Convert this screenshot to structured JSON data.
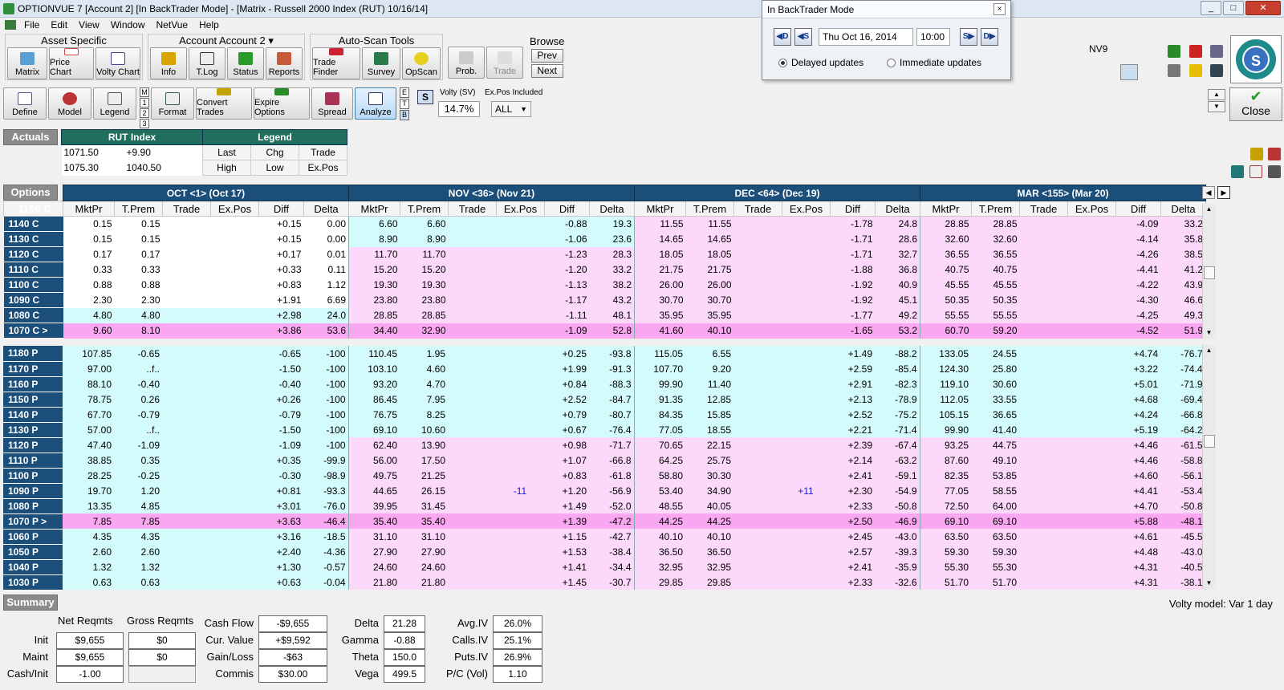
{
  "window": {
    "title": "OPTIONVUE 7   [Account 2]   [In BackTrader Mode]  - [Matrix - Russell 2000 Index (RUT)  10/16/14]"
  },
  "menu": [
    "File",
    "Edit",
    "View",
    "Window",
    "NetVue",
    "Help"
  ],
  "toolbar1": {
    "asset_label": "Asset Specific",
    "asset_buttons": [
      "Matrix",
      "Price Chart",
      "Volty Chart"
    ],
    "account_label": "Account Account 2 ▾",
    "account_buttons": [
      "Info",
      "T.Log",
      "Status",
      "Reports"
    ],
    "autoscan_label": "Auto-Scan Tools",
    "autoscan_buttons": [
      "Trade Finder",
      "Survey",
      "OpScan"
    ],
    "prob": "Prob.",
    "trade": "Trade",
    "browse_label": "Browse",
    "prev": "Prev",
    "next": "Next",
    "nv9": "NV9"
  },
  "toolbar2": {
    "buttons": [
      "Define",
      "Model",
      "Legend",
      "Format",
      "Convert Trades",
      "Expire Options",
      "Spread",
      "Analyze"
    ],
    "stack": [
      "M",
      "1",
      "2",
      "3"
    ],
    "etb": [
      "E",
      "T",
      "B"
    ],
    "s_btn": "S",
    "volty_label": "Volty (SV)",
    "volty_value": "14.7%",
    "expos_label": "Ex.Pos Included",
    "expos_value": "ALL",
    "close": "Close"
  },
  "backtrader": {
    "title": "In BackTrader Mode",
    "close": "×",
    "btn1": "◀D",
    "btn2": "◀S",
    "date": "Thu Oct 16, 2014",
    "time": "10:00",
    "btn3": "S▶",
    "btn4": "D▶",
    "radio1": "Delayed updates",
    "radio2": "Immediate updates"
  },
  "actuals": {
    "label": "Actuals",
    "index_header": "RUT Index",
    "legend_header": "Legend",
    "values": [
      "1071.50",
      "+9.90",
      "1075.30",
      "1040.50"
    ],
    "legend": [
      "Last",
      "Chg",
      "Trade",
      "High",
      "Low",
      "Ex.Pos"
    ]
  },
  "options": {
    "label": "Options",
    "months": [
      "OCT <1> (Oct 17)",
      "NOV <36> (Nov 21)",
      "DEC <64> (Dec 19)",
      "MAR <155> (Mar 20)"
    ],
    "col_headers": [
      "MktPr",
      "T.Prem",
      "Trade",
      "Ex.Pos",
      "Diff",
      "Delta"
    ],
    "calls": [
      {
        "s": "1150 C",
        "c": "white",
        "m": [
          [
            "",
            "",
            "",
            "",
            "",
            ""
          ],
          [
            "",
            "",
            "",
            "",
            "",
            ""
          ],
          [
            "",
            "",
            "",
            "",
            "",
            ""
          ],
          [
            "",
            "",
            "",
            "",
            "",
            ""
          ]
        ]
      },
      {
        "s": "1140 C",
        "c": "white",
        "m": [
          [
            "0.15",
            "0.15",
            "",
            "",
            "+0.15",
            "0.00"
          ],
          [
            "6.60",
            "6.60",
            "",
            "",
            "-0.88",
            "19.3"
          ],
          [
            "11.55",
            "11.55",
            "",
            "",
            "-1.78",
            "24.8"
          ],
          [
            "28.85",
            "28.85",
            "",
            "",
            "-4.09",
            "33.2"
          ]
        ]
      },
      {
        "s": "1130 C",
        "c": "white",
        "m": [
          [
            "0.15",
            "0.15",
            "",
            "",
            "+0.15",
            "0.00"
          ],
          [
            "8.90",
            "8.90",
            "",
            "",
            "-1.06",
            "23.6"
          ],
          [
            "14.65",
            "14.65",
            "",
            "",
            "-1.71",
            "28.6"
          ],
          [
            "32.60",
            "32.60",
            "",
            "",
            "-4.14",
            "35.8"
          ]
        ]
      },
      {
        "s": "1120 C",
        "c": "white",
        "m": [
          [
            "0.17",
            "0.17",
            "",
            "",
            "+0.17",
            "0.01"
          ],
          [
            "11.70",
            "11.70",
            "",
            "",
            "-1.23",
            "28.3"
          ],
          [
            "18.05",
            "18.05",
            "",
            "",
            "-1.71",
            "32.7"
          ],
          [
            "36.55",
            "36.55",
            "",
            "",
            "-4.26",
            "38.5"
          ]
        ]
      },
      {
        "s": "1110 C",
        "c": "white",
        "m": [
          [
            "0.33",
            "0.33",
            "",
            "",
            "+0.33",
            "0.11"
          ],
          [
            "15.20",
            "15.20",
            "",
            "",
            "-1.20",
            "33.2"
          ],
          [
            "21.75",
            "21.75",
            "",
            "",
            "-1.88",
            "36.8"
          ],
          [
            "40.75",
            "40.75",
            "",
            "",
            "-4.41",
            "41.2"
          ]
        ]
      },
      {
        "s": "1100 C",
        "c": "white",
        "m": [
          [
            "0.88",
            "0.88",
            "",
            "",
            "+0.83",
            "1.12"
          ],
          [
            "19.30",
            "19.30",
            "",
            "",
            "-1.13",
            "38.2"
          ],
          [
            "26.00",
            "26.00",
            "",
            "",
            "-1.92",
            "40.9"
          ],
          [
            "45.55",
            "45.55",
            "",
            "",
            "-4.22",
            "43.9"
          ]
        ]
      },
      {
        "s": "1090 C",
        "c": "white",
        "m": [
          [
            "2.30",
            "2.30",
            "",
            "",
            "+1.91",
            "6.69"
          ],
          [
            "23.80",
            "23.80",
            "",
            "",
            "-1.17",
            "43.2"
          ],
          [
            "30.70",
            "30.70",
            "",
            "",
            "-1.92",
            "45.1"
          ],
          [
            "50.35",
            "50.35",
            "",
            "",
            "-4.30",
            "46.6"
          ]
        ]
      },
      {
        "s": "1080 C",
        "c": "cyan",
        "m": [
          [
            "4.80",
            "4.80",
            "",
            "",
            "+2.98",
            "24.0"
          ],
          [
            "28.85",
            "28.85",
            "",
            "",
            "-1.11",
            "48.1"
          ],
          [
            "35.95",
            "35.95",
            "",
            "",
            "-1.77",
            "49.2"
          ],
          [
            "55.55",
            "55.55",
            "",
            "",
            "-4.25",
            "49.3"
          ]
        ]
      },
      {
        "s": "1070 C >",
        "c": "atm",
        "m": [
          [
            "9.60",
            "8.10",
            "",
            "",
            "+3.86",
            "53.6"
          ],
          [
            "34.40",
            "32.90",
            "",
            "",
            "-1.09",
            "52.8"
          ],
          [
            "41.60",
            "40.10",
            "",
            "",
            "-1.65",
            "53.2"
          ],
          [
            "60.70",
            "59.20",
            "",
            "",
            "-4.52",
            "51.9"
          ]
        ]
      }
    ],
    "puts": [
      {
        "s": "1180 P",
        "c": "cyan",
        "m": [
          [
            "107.85",
            "-0.65",
            "",
            "",
            "-0.65",
            "-100"
          ],
          [
            "110.45",
            "1.95",
            "",
            "",
            "+0.25",
            "-93.8"
          ],
          [
            "115.05",
            "6.55",
            "",
            "",
            "+1.49",
            "-88.2"
          ],
          [
            "133.05",
            "24.55",
            "",
            "",
            "+4.74",
            "-76.7"
          ]
        ]
      },
      {
        "s": "1170 P",
        "c": "cyan",
        "m": [
          [
            "97.00",
            "..f..",
            "",
            "",
            "-1.50",
            "-100"
          ],
          [
            "103.10",
            "4.60",
            "",
            "",
            "+1.99",
            "-91.3"
          ],
          [
            "107.70",
            "9.20",
            "",
            "",
            "+2.59",
            "-85.4"
          ],
          [
            "124.30",
            "25.80",
            "",
            "",
            "+3.22",
            "-74.4"
          ]
        ]
      },
      {
        "s": "1160 P",
        "c": "cyan",
        "m": [
          [
            "88.10",
            "-0.40",
            "",
            "",
            "-0.40",
            "-100"
          ],
          [
            "93.20",
            "4.70",
            "",
            "",
            "+0.84",
            "-88.3"
          ],
          [
            "99.90",
            "11.40",
            "",
            "",
            "+2.91",
            "-82.3"
          ],
          [
            "119.10",
            "30.60",
            "",
            "",
            "+5.01",
            "-71.9"
          ]
        ]
      },
      {
        "s": "1150 P",
        "c": "cyan",
        "m": [
          [
            "78.75",
            "0.26",
            "",
            "",
            "+0.26",
            "-100"
          ],
          [
            "86.45",
            "7.95",
            "",
            "",
            "+2.52",
            "-84.7"
          ],
          [
            "91.35",
            "12.85",
            "",
            "",
            "+2.13",
            "-78.9"
          ],
          [
            "112.05",
            "33.55",
            "",
            "",
            "+4.68",
            "-69.4"
          ]
        ]
      },
      {
        "s": "1140 P",
        "c": "cyan",
        "m": [
          [
            "67.70",
            "-0.79",
            "",
            "",
            "-0.79",
            "-100"
          ],
          [
            "76.75",
            "8.25",
            "",
            "",
            "+0.79",
            "-80.7"
          ],
          [
            "84.35",
            "15.85",
            "",
            "",
            "+2.52",
            "-75.2"
          ],
          [
            "105.15",
            "36.65",
            "",
            "",
            "+4.24",
            "-66.8"
          ]
        ]
      },
      {
        "s": "1130 P",
        "c": "cyan",
        "m": [
          [
            "57.00",
            "..f..",
            "",
            "",
            "-1.50",
            "-100"
          ],
          [
            "69.10",
            "10.60",
            "",
            "",
            "+0.67",
            "-76.4"
          ],
          [
            "77.05",
            "18.55",
            "",
            "",
            "+2.21",
            "-71.4"
          ],
          [
            "99.90",
            "41.40",
            "",
            "",
            "+5.19",
            "-64.2"
          ]
        ]
      },
      {
        "s": "1120 P",
        "c": "cyan",
        "m": [
          [
            "47.40",
            "-1.09",
            "",
            "",
            "-1.09",
            "-100"
          ],
          [
            "62.40",
            "13.90",
            "",
            "",
            "+0.98",
            "-71.7"
          ],
          [
            "70.65",
            "22.15",
            "",
            "",
            "+2.39",
            "-67.4"
          ],
          [
            "93.25",
            "44.75",
            "",
            "",
            "+4.46",
            "-61.5"
          ]
        ]
      },
      {
        "s": "1110 P",
        "c": "cyan",
        "m": [
          [
            "38.85",
            "0.35",
            "",
            "",
            "+0.35",
            "-99.9"
          ],
          [
            "56.00",
            "17.50",
            "",
            "",
            "+1.07",
            "-66.8"
          ],
          [
            "64.25",
            "25.75",
            "",
            "",
            "+2.14",
            "-63.2"
          ],
          [
            "87.60",
            "49.10",
            "",
            "",
            "+4.46",
            "-58.8"
          ]
        ]
      },
      {
        "s": "1100 P",
        "c": "cyan",
        "m": [
          [
            "28.25",
            "-0.25",
            "",
            "",
            "-0.30",
            "-98.9"
          ],
          [
            "49.75",
            "21.25",
            "",
            "",
            "+0.83",
            "-61.8"
          ],
          [
            "58.80",
            "30.30",
            "",
            "",
            "+2.41",
            "-59.1"
          ],
          [
            "82.35",
            "53.85",
            "",
            "",
            "+4.60",
            "-56.1"
          ]
        ]
      },
      {
        "s": "1090 P",
        "c": "cyan",
        "m": [
          [
            "19.70",
            "1.20",
            "",
            "",
            "+0.81",
            "-93.3"
          ],
          [
            "44.65",
            "26.15",
            "",
            "-11",
            "+1.20",
            "-56.9"
          ],
          [
            "53.40",
            "34.90",
            "",
            "+11",
            "+2.30",
            "-54.9"
          ],
          [
            "77.05",
            "58.55",
            "",
            "",
            "+4.41",
            "-53.4"
          ]
        ]
      },
      {
        "s": "1080 P",
        "c": "cyan",
        "m": [
          [
            "13.35",
            "4.85",
            "",
            "",
            "+3.01",
            "-76.0"
          ],
          [
            "39.95",
            "31.45",
            "",
            "",
            "+1.49",
            "-52.0"
          ],
          [
            "48.55",
            "40.05",
            "",
            "",
            "+2.33",
            "-50.8"
          ],
          [
            "72.50",
            "64.00",
            "",
            "",
            "+4.70",
            "-50.8"
          ]
        ]
      },
      {
        "s": "1070 P >",
        "c": "atm",
        "m": [
          [
            "7.85",
            "7.85",
            "",
            "",
            "+3.63",
            "-46.4"
          ],
          [
            "35.40",
            "35.40",
            "",
            "",
            "+1.39",
            "-47.2"
          ],
          [
            "44.25",
            "44.25",
            "",
            "",
            "+2.50",
            "-46.9"
          ],
          [
            "69.10",
            "69.10",
            "",
            "",
            "+5.88",
            "-48.1"
          ]
        ]
      },
      {
        "s": "1060 P",
        "c": "white",
        "m": [
          [
            "4.35",
            "4.35",
            "",
            "",
            "+3.16",
            "-18.5"
          ],
          [
            "31.10",
            "31.10",
            "",
            "",
            "+1.15",
            "-42.7"
          ],
          [
            "40.10",
            "40.10",
            "",
            "",
            "+2.45",
            "-43.0"
          ],
          [
            "63.50",
            "63.50",
            "",
            "",
            "+4.61",
            "-45.5"
          ]
        ]
      },
      {
        "s": "1050 P",
        "c": "white",
        "m": [
          [
            "2.60",
            "2.60",
            "",
            "",
            "+2.40",
            "-4.36"
          ],
          [
            "27.90",
            "27.90",
            "",
            "",
            "+1.53",
            "-38.4"
          ],
          [
            "36.50",
            "36.50",
            "",
            "",
            "+2.57",
            "-39.3"
          ],
          [
            "59.30",
            "59.30",
            "",
            "",
            "+4.48",
            "-43.0"
          ]
        ]
      },
      {
        "s": "1040 P",
        "c": "white",
        "m": [
          [
            "1.32",
            "1.32",
            "",
            "",
            "+1.30",
            "-0.57"
          ],
          [
            "24.60",
            "24.60",
            "",
            "",
            "+1.41",
            "-34.4"
          ],
          [
            "32.95",
            "32.95",
            "",
            "",
            "+2.41",
            "-35.9"
          ],
          [
            "55.30",
            "55.30",
            "",
            "",
            "+4.31",
            "-40.5"
          ]
        ]
      },
      {
        "s": "1030 P",
        "c": "white",
        "m": [
          [
            "0.63",
            "0.63",
            "",
            "",
            "+0.63",
            "-0.04"
          ],
          [
            "21.80",
            "21.80",
            "",
            "",
            "+1.45",
            "-30.7"
          ],
          [
            "29.85",
            "29.85",
            "",
            "",
            "+2.33",
            "-32.6"
          ],
          [
            "51.70",
            "51.70",
            "",
            "",
            "+4.31",
            "-38.1"
          ]
        ]
      }
    ]
  },
  "summary": {
    "label": "Summary",
    "volty_model": "Volty model: Var 1 day",
    "net_reqmts": "Net Reqmts",
    "gross_reqmts": "Gross Reqmts",
    "init_label": "Init",
    "init_net": "$9,655",
    "init_gross": "$0",
    "maint_label": "Maint",
    "maint_net": "$9,655",
    "maint_gross": "$0",
    "cashinit_label": "Cash/Init",
    "cashinit_val": "-1.00",
    "cashflow_label": "Cash Flow",
    "cashflow_val": "-$9,655",
    "curvalue_label": "Cur. Value",
    "curvalue_val": "+$9,592",
    "gainloss_label": "Gain/Loss",
    "gainloss_val": "-$63",
    "commis_label": "Commis",
    "commis_val": "$30.00",
    "delta_label": "Delta",
    "delta_val": "21.28",
    "gamma_label": "Gamma",
    "gamma_val": "-0.88",
    "theta_label": "Theta",
    "theta_val": "150.0",
    "vega_label": "Vega",
    "vega_val": "499.5",
    "avgiv_label": "Avg.IV",
    "avgiv_val": "26.0%",
    "callsiv_label": "Calls.IV",
    "callsiv_val": "25.1%",
    "putsiv_label": "Puts.IV",
    "putsiv_val": "26.9%",
    "pcvol_label": "P/C (Vol)",
    "pcvol_val": "1.10"
  }
}
